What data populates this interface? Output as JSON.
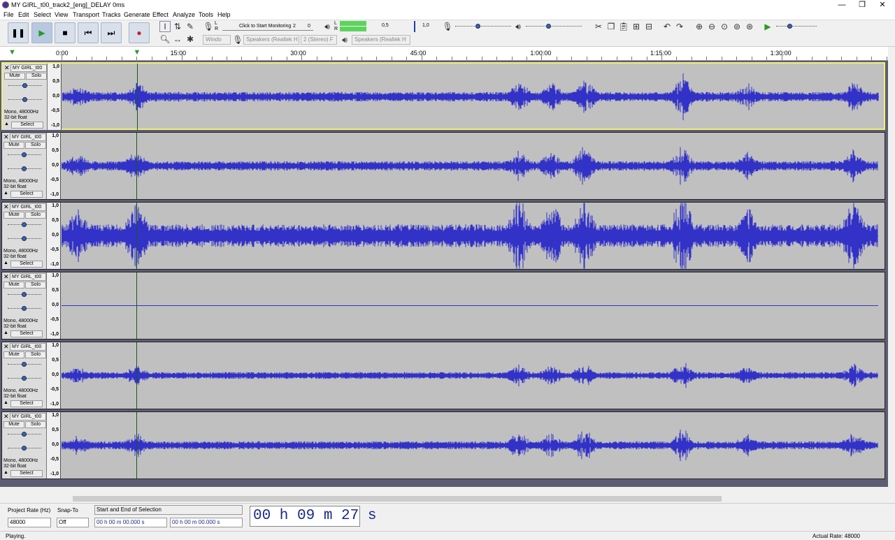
{
  "app": {
    "title": "MY GIRL_t00_track2_[eng]_DELAY 0ms",
    "icon": "audacity-logo-icon"
  },
  "window_controls": {
    "minimize": "—",
    "maximize": "❐",
    "close": "✕"
  },
  "menu": [
    "File",
    "Edit",
    "Select",
    "View",
    "Transport",
    "Tracks",
    "Generate",
    "Effect",
    "Analyze",
    "Tools",
    "Help"
  ],
  "transport": {
    "pause": "pause-icon",
    "play": "play-icon",
    "stop": "stop-icon",
    "skip_start": "skip-start-icon",
    "skip_end": "skip-end-icon",
    "record": "record-icon"
  },
  "meters": {
    "record_label": "Click to Start Monitoring",
    "record_channels": "L R",
    "rec_value_2": "2",
    "rec_value_0": "0",
    "play_channels": "L R",
    "play_05": "0,5",
    "play_10": "1,0",
    "record_level": 0.4,
    "playback_level": 0.4
  },
  "device": {
    "host": "Windo",
    "recording": "Speakers (Realtek H",
    "rec_channels": "2 (Stereo) F",
    "playback": "Speakers (Realtek H"
  },
  "ruler": {
    "labels": [
      "0:00",
      "15:00",
      "30:00",
      "45:00",
      "1:00:00",
      "1:15:00",
      "1:30:00"
    ],
    "playhead_fraction": 0.092
  },
  "tracks": [
    {
      "name": "MY GIRL_t00",
      "mute": "Mute",
      "solo": "Solo",
      "info1": "Mono, 48000Hz",
      "info2": "32-bit float",
      "select": "Select",
      "selected": true,
      "amp": 0.35
    },
    {
      "name": "MY GIRL_t00",
      "mute": "Mute",
      "solo": "Solo",
      "info1": "Mono, 48000Hz",
      "info2": "32-bit float",
      "select": "Select",
      "selected": false,
      "amp": 0.35
    },
    {
      "name": "MY GIRL_t00",
      "mute": "Mute",
      "solo": "Solo",
      "info1": "Mono, 48000Hz",
      "info2": "32-bit float",
      "select": "Select",
      "selected": false,
      "amp": 0.85
    },
    {
      "name": "MY GIRL_t00",
      "mute": "Mute",
      "solo": "Solo",
      "info1": "Mono, 48000Hz",
      "info2": "32-bit float",
      "select": "Select",
      "selected": false,
      "amp": 0.0
    },
    {
      "name": "MY GIRL_t00",
      "mute": "Mute",
      "solo": "Solo",
      "info1": "Mono, 48000Hz",
      "info2": "32-bit float",
      "select": "Select",
      "selected": false,
      "amp": 0.25
    },
    {
      "name": "MY GIRL_t00",
      "mute": "Mute",
      "solo": "Solo",
      "info1": "Mono, 48000Hz",
      "info2": "32-bit float",
      "select": "Select",
      "selected": false,
      "amp": 0.3
    }
  ],
  "vscale": [
    "1,0",
    "0,5",
    "0,0",
    "-0,5",
    "-1,0"
  ],
  "selection": {
    "project_rate_label": "Project Rate (Hz)",
    "snap_label": "Snap-To",
    "rate": "48000",
    "snap": "Off",
    "mode": "Start and End of Selection",
    "start": "00 h 00 m 00.000 s",
    "end": "00 h 00 m 00.000 s",
    "time": "00 h 09 m 27 s"
  },
  "status": {
    "left": "Playing.",
    "right": "Actual Rate: 48000"
  },
  "colors": {
    "wave": "#3232c8",
    "accent": "#3a5fbf"
  }
}
